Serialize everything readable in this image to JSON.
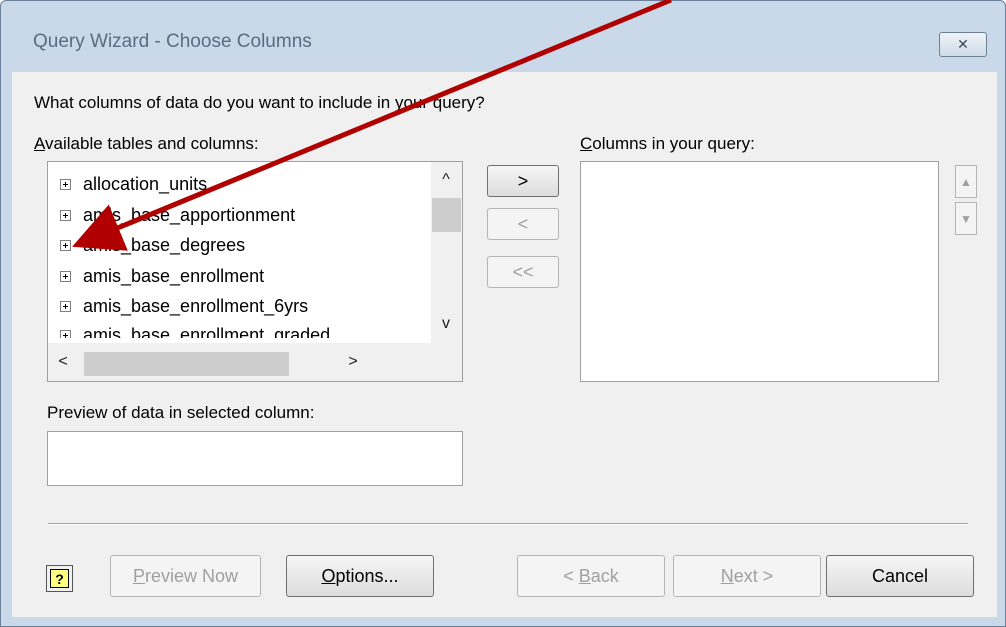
{
  "window": {
    "title": "Query Wizard - Choose Columns",
    "close_glyph": "✕"
  },
  "prompt": "What columns of data do you want to include in your query?",
  "available": {
    "label_accel": "A",
    "label_rest": "vailable tables and columns:",
    "items": [
      "allocation_units",
      "amis_base_apportionment",
      "amis_base_degrees",
      "amis_base_enrollment",
      "amis_base_enrollment_6yrs",
      "amis_base_enrollment_graded"
    ]
  },
  "columns": {
    "label_accel": "C",
    "label_rest": "olumns in your query:"
  },
  "move_buttons": {
    "add": ">",
    "remove": "<",
    "remove_all": "<<"
  },
  "order_buttons": {
    "up": "▲",
    "down": "▼"
  },
  "preview": {
    "label": "Preview of data in selected column:",
    "value": ""
  },
  "footer": {
    "help": "?",
    "preview_now_accel": "P",
    "preview_now_rest": "review Now",
    "options_accel": "O",
    "options_rest": "ptions...",
    "back_prefix": "< ",
    "back_accel": "B",
    "back_rest": "ack",
    "next_accel": "N",
    "next_rest": "ext >",
    "cancel": "Cancel"
  },
  "scroll_glyphs": {
    "up": "^",
    "down": "v",
    "left": "<",
    "right": ">"
  },
  "colors": {
    "title_bar": "#c9d9ea",
    "dialog_face": "#f0f0f0",
    "annotation_arrow": "#b00000",
    "disabled_text": "#a0a0a0"
  }
}
